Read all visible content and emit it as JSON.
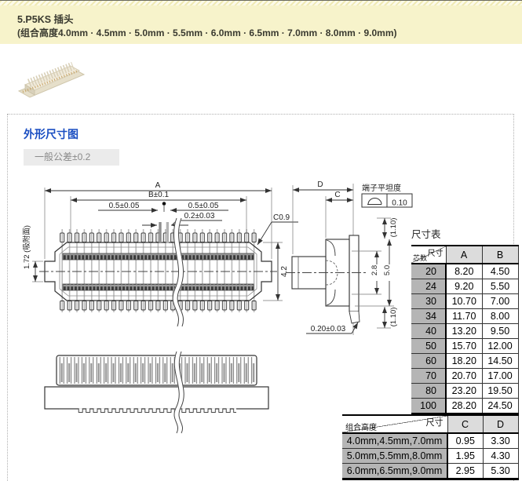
{
  "header": {
    "title": "5.P5KS 插头",
    "subtitle": "(组合高度4.0mm · 4.5mm · 5.0mm · 5.5mm · 6.0mm · 6.5mm · 7.0mm · 8.0mm · 9.0mm)"
  },
  "section": {
    "title": "外形尺寸图",
    "tolerance_note": "一般公差±0.2"
  },
  "drawing": {
    "labels": {
      "dim_a": "A",
      "dim_b": "B±0.1",
      "dim_half_left": "0.5±0.05",
      "dim_half_right": "0.5±0.05",
      "dim_gap": "0.2±0.03",
      "chamfer": "C0.9",
      "dim_suction": "1.72 (吸附面)",
      "dim_height": "4.2",
      "dim_d": "D",
      "dim_c": "C",
      "flatness_title": "端子平坦度",
      "flatness_value": "0.10",
      "dim_110_top": "(1.10)",
      "dim_110_bottom": "(1.10)",
      "dim_28": "2.8",
      "dim_50": "5.0",
      "dim_020": "0.20±0.03"
    }
  },
  "size_table": {
    "title": "尺寸表",
    "corner_top": "尺寸",
    "corner_bottom": "芯数",
    "col_a": "A",
    "col_b": "B",
    "rows": [
      [
        "20",
        "8.20",
        "4.50"
      ],
      [
        "24",
        "9.20",
        "5.50"
      ],
      [
        "30",
        "10.70",
        "7.00"
      ],
      [
        "34",
        "11.70",
        "8.00"
      ],
      [
        "40",
        "13.20",
        "9.50"
      ],
      [
        "50",
        "15.70",
        "12.00"
      ],
      [
        "60",
        "18.20",
        "14.50"
      ],
      [
        "70",
        "20.70",
        "17.00"
      ],
      [
        "80",
        "23.20",
        "19.50"
      ],
      [
        "100",
        "28.20",
        "24.50"
      ]
    ]
  },
  "height_table": {
    "corner_top": "尺寸",
    "corner_bottom": "组合高度",
    "col_c": "C",
    "col_d": "D",
    "rows": [
      [
        "4.0mm,4.5mm,7.0mm",
        "0.95",
        "3.30"
      ],
      [
        "5.0mm,5.5mm,8.0mm",
        "1.95",
        "4.30"
      ],
      [
        "6.0mm,6.5mm,9.0mm",
        "2.95",
        "5.30"
      ]
    ]
  }
}
